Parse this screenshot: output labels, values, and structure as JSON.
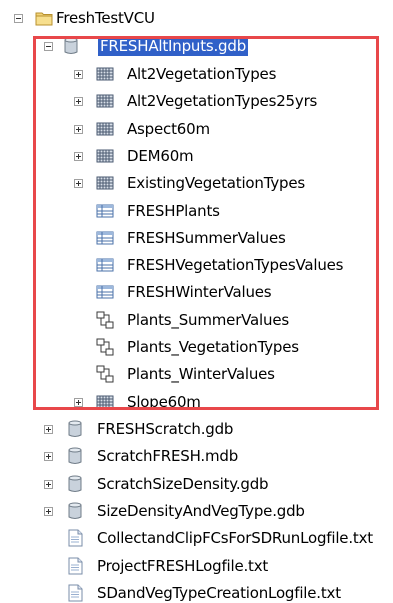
{
  "tree": {
    "root": {
      "label": "FreshTestVCU",
      "icon": "folder-icon",
      "expanded": true
    },
    "selected_gdb": {
      "label": "FRESHAltInputs.gdb",
      "icon": "geodatabase-icon",
      "expanded": true,
      "selected": true,
      "children": [
        {
          "label": "Alt2VegetationTypes",
          "icon": "raster-dataset-icon",
          "expandable": true
        },
        {
          "label": "Alt2VegetationTypes25yrs",
          "icon": "raster-dataset-icon",
          "expandable": true
        },
        {
          "label": "Aspect60m",
          "icon": "raster-dataset-icon",
          "expandable": true
        },
        {
          "label": "DEM60m",
          "icon": "raster-dataset-icon",
          "expandable": true
        },
        {
          "label": "ExistingVegetationTypes",
          "icon": "raster-dataset-icon",
          "expandable": true
        },
        {
          "label": "FRESHPlants",
          "icon": "table-icon",
          "expandable": false
        },
        {
          "label": "FRESHSummerValues",
          "icon": "table-icon",
          "expandable": false
        },
        {
          "label": "FRESHVegetationTypesValues",
          "icon": "table-icon",
          "expandable": false
        },
        {
          "label": "FRESHWinterValues",
          "icon": "table-icon",
          "expandable": false
        },
        {
          "label": "Plants_SummerValues",
          "icon": "relationship-class-icon",
          "expandable": false
        },
        {
          "label": "Plants_VegetationTypes",
          "icon": "relationship-class-icon",
          "expandable": false
        },
        {
          "label": "Plants_WinterValues",
          "icon": "relationship-class-icon",
          "expandable": false
        },
        {
          "label": "Slope60m",
          "icon": "raster-dataset-icon",
          "expandable": true
        }
      ]
    },
    "siblings": [
      {
        "label": "FRESHScratch.gdb",
        "icon": "geodatabase-icon",
        "expandable": true
      },
      {
        "label": "ScratchFRESH.mdb",
        "icon": "geodatabase-icon",
        "expandable": true
      },
      {
        "label": "ScratchSizeDensity.gdb",
        "icon": "geodatabase-icon",
        "expandable": true
      },
      {
        "label": "SizeDensityAndVegType.gdb",
        "icon": "geodatabase-icon",
        "expandable": true
      },
      {
        "label": "CollectandClipFCsForSDRunLogfile.txt",
        "icon": "text-file-icon",
        "expandable": false
      },
      {
        "label": "ProjectFRESHLogfile.txt",
        "icon": "text-file-icon",
        "expandable": false
      },
      {
        "label": "SDandVegTypeCreationLogfile.txt",
        "icon": "text-file-icon",
        "expandable": false
      }
    ]
  },
  "colors": {
    "selection": "#3060c8",
    "highlight_border": "#e8474a"
  }
}
